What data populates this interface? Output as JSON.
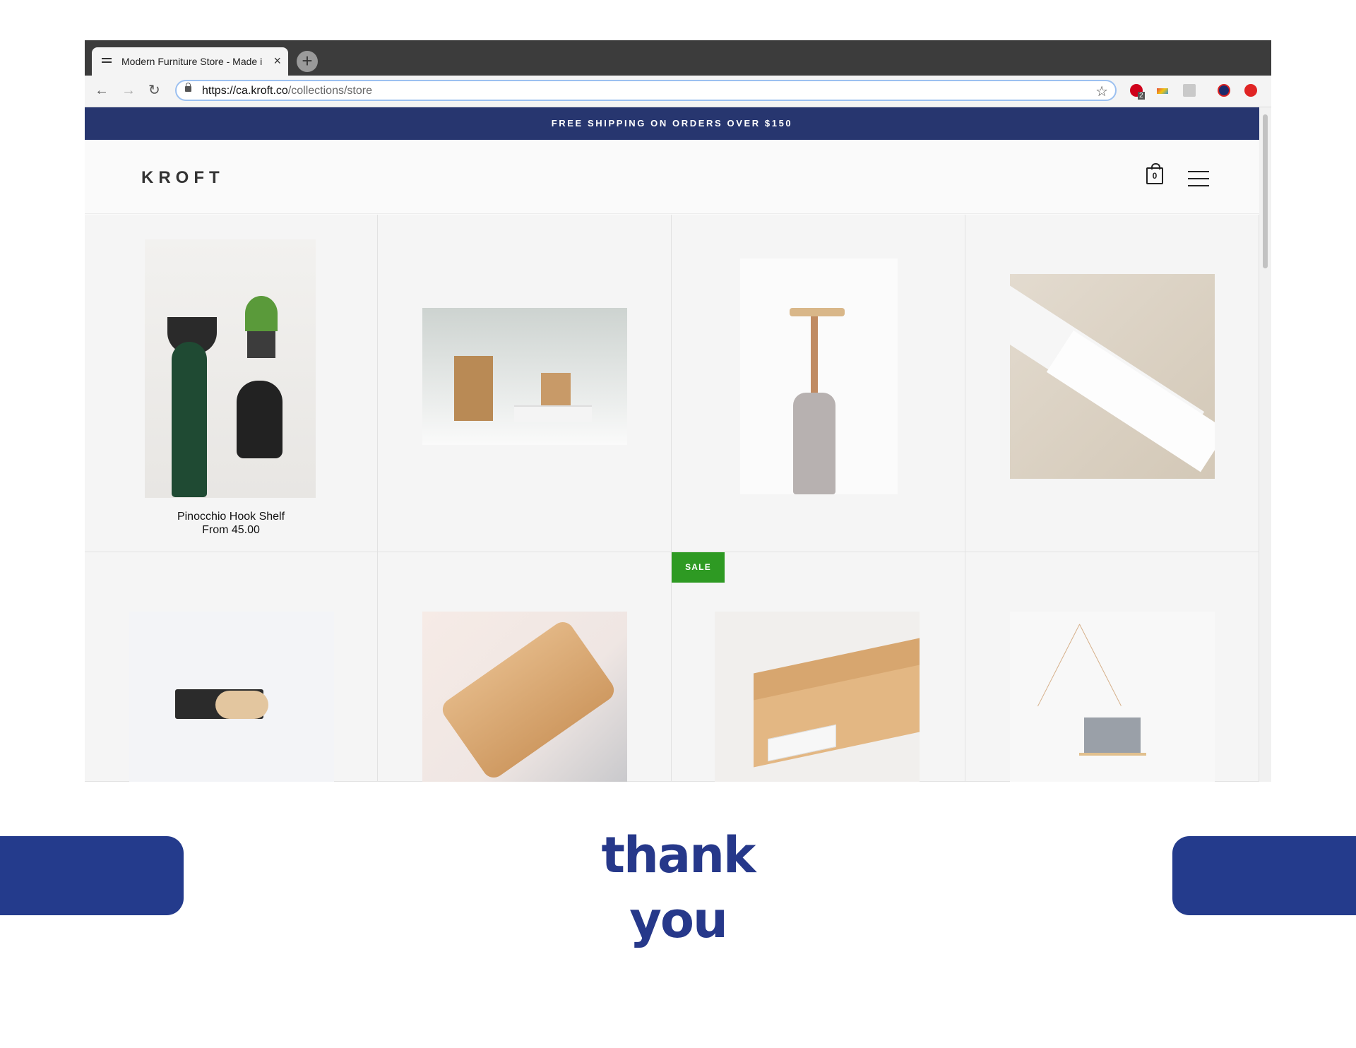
{
  "browser": {
    "tab_title": "Modern Furniture Store - Made in Canada",
    "new_tab": "+",
    "close": "×",
    "url_host": "https://ca.kroft.co",
    "url_path": "/collections/store",
    "ext_badge": "2"
  },
  "site": {
    "announcement": "FREE SHIPPING ON ORDERS OVER $150",
    "logo": "KROFT",
    "cart_count": "0"
  },
  "products": [
    {
      "name": "Pinocchio Hook Shelf",
      "price": "From 45.00"
    },
    {
      "name": "",
      "price": ""
    },
    {
      "name": "",
      "price": ""
    },
    {
      "name": "",
      "price": ""
    },
    {
      "name": "",
      "price": ""
    },
    {
      "name": "",
      "price": ""
    },
    {
      "name": "",
      "price": "",
      "badge": "SALE"
    },
    {
      "name": "",
      "price": ""
    }
  ],
  "slide": {
    "line1": "thank",
    "line2": "you"
  },
  "colors": {
    "announcement_bg": "#27366f",
    "sale_badge": "#2e9a23",
    "thanks_text": "#26388a",
    "pill": "#243b8c"
  }
}
